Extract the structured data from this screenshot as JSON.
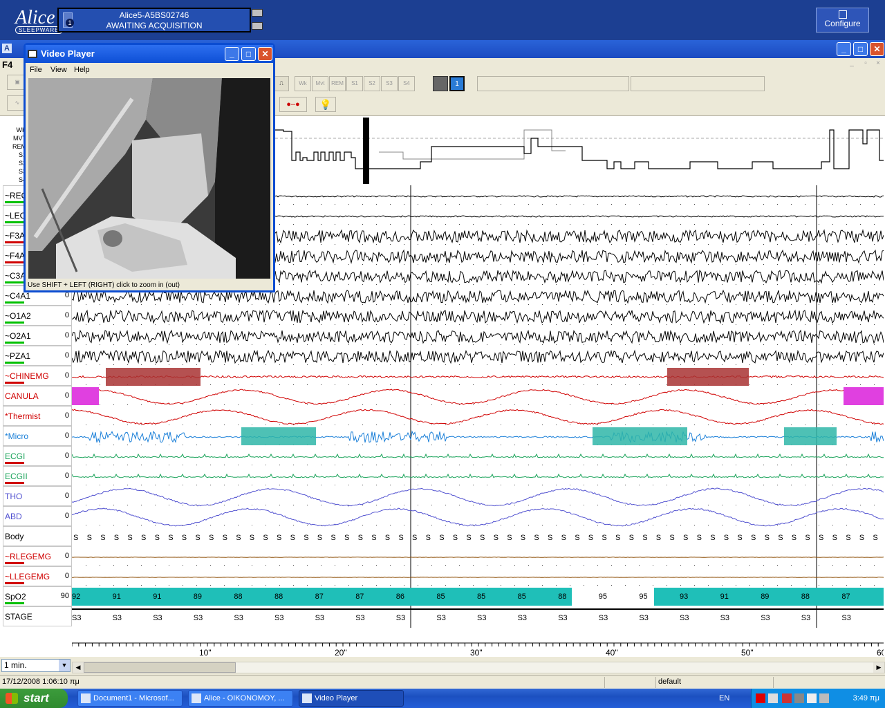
{
  "banner": {
    "logo": "Alice",
    "logo_sub": "SLEEPWARE",
    "device_badge": "1",
    "device_name": "Alice5-A5BS02746",
    "device_status": "AWAITING ACQUISITION",
    "configure_label": "Configure"
  },
  "main_window": {
    "app_icon": "A",
    "menu_channel": "F4",
    "min_btn": "_",
    "max_btn": "□",
    "close_btn": "✕"
  },
  "toolbar": {
    "stage_buttons": [
      "Wk",
      "Mvt",
      "REM",
      "S1",
      "S2",
      "S3",
      "S4"
    ],
    "view_badge": "1",
    "bulb_icon": "bulb-icon"
  },
  "hypnogram": {
    "stage_labels": [
      "WK",
      "MVT",
      "REM",
      "S1",
      "S2",
      "S3",
      "S4"
    ]
  },
  "channels": [
    {
      "label": "~REOG",
      "value": "0",
      "color": "#000000",
      "bar": "#00c000"
    },
    {
      "label": "~LEOG",
      "value": "0",
      "color": "#000000",
      "bar": "#00c000"
    },
    {
      "label": "~F3A2",
      "value": "0",
      "color": "#000000",
      "bar": "#d00000"
    },
    {
      "label": "~F4A1",
      "value": "0",
      "color": "#000000",
      "bar": "#d00000"
    },
    {
      "label": "~C3A2",
      "value": "0",
      "color": "#000000",
      "bar": "#00c000"
    },
    {
      "label": "~C4A1",
      "value": "0",
      "color": "#000000",
      "bar": "#00c000"
    },
    {
      "label": "~O1A2",
      "value": "0",
      "color": "#000000",
      "bar": "#00c000"
    },
    {
      "label": "~O2A1",
      "value": "0",
      "color": "#000000",
      "bar": "#00c000"
    },
    {
      "label": "~PZA1",
      "value": "0",
      "color": "#000000",
      "bar": "#00c000"
    },
    {
      "label": "~CHINEMG",
      "value": "0",
      "color": "#d00000",
      "bar": "#d00000"
    },
    {
      "label": "CANULA",
      "value": "0",
      "color": "#d00000",
      "bar": ""
    },
    {
      "label": "*Thermist",
      "value": "0",
      "color": "#d00000",
      "bar": ""
    },
    {
      "label": "*Micro",
      "value": "0",
      "color": "#1a7fd8",
      "bar": ""
    },
    {
      "label": "ECGI",
      "value": "0",
      "color": "#1aa35a",
      "bar": "#d00000"
    },
    {
      "label": "ECGII",
      "value": "0",
      "color": "#1aa35a",
      "bar": "#d00000"
    },
    {
      "label": "THO",
      "value": "0",
      "color": "#5050d0",
      "bar": ""
    },
    {
      "label": "ABD",
      "value": "0",
      "color": "#5050d0",
      "bar": ""
    },
    {
      "label": "Body",
      "value": "",
      "color": "#000000",
      "bar": ""
    },
    {
      "label": "~RLEGEMG",
      "value": "0",
      "color": "#d00000",
      "bar": "#d00000"
    },
    {
      "label": "~LLEGEMG",
      "value": "0",
      "color": "#d00000",
      "bar": "#d00000"
    },
    {
      "label": "SpO2",
      "value": "90",
      "color": "#000000",
      "bar": "#00c000"
    },
    {
      "label": "STAGE",
      "value": "",
      "color": "#000000",
      "bar": ""
    }
  ],
  "body_marker": "S",
  "spo2_values": [
    "92",
    "91",
    "91",
    "89",
    "88",
    "88",
    "87",
    "87",
    "86",
    "85",
    "85",
    "85",
    "88",
    "95",
    "95",
    "93",
    "91",
    "89",
    "88",
    "87"
  ],
  "stage_values": [
    "S3",
    "S3",
    "S3",
    "S3",
    "S3",
    "S3",
    "S3",
    "S3",
    "S3",
    "S3",
    "S3",
    "S3",
    "S3",
    "S3",
    "S3",
    "S3",
    "S3",
    "S3",
    "S3",
    "S3"
  ],
  "time_axis": [
    "10\"",
    "20\"",
    "30\"",
    "40\"",
    "50\"",
    "60"
  ],
  "timebase": "1 min.",
  "status": {
    "datetime": "17/12/2008 1:06:10 πμ",
    "profile": "default"
  },
  "video_player": {
    "title": "Video Player",
    "menu": [
      "File",
      "View",
      "Help"
    ],
    "status": "Use SHIFT + LEFT (RIGHT) click to zoom in (out)"
  },
  "taskbar": {
    "start": "start",
    "tasks": [
      {
        "label": "Document1 - Microsof...",
        "active": false
      },
      {
        "label": "Alice - OIKONOMOY, ...",
        "active": false
      },
      {
        "label": "Video Player",
        "active": true
      }
    ],
    "lang": "EN",
    "clock": "3:49 πμ"
  },
  "colors": {
    "banner": "#1c3f92",
    "emg_event": "#a83232",
    "canula_event": "#e040e0",
    "micro_event": "#2fb6a8",
    "spo2_band": "#1fbfb8"
  }
}
